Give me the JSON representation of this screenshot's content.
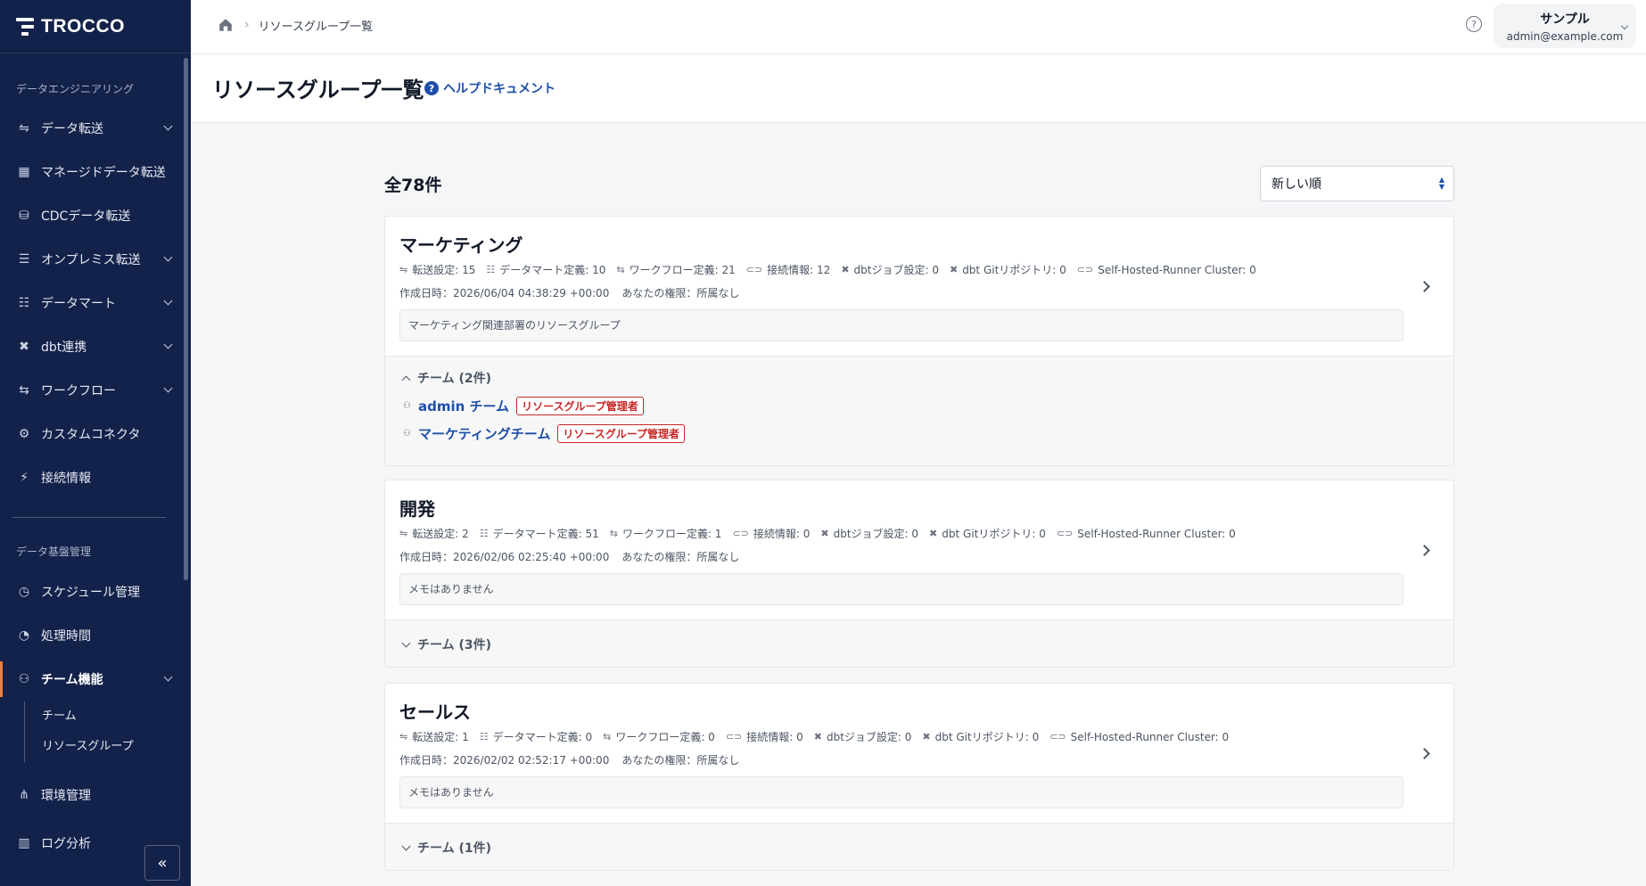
{
  "app": {
    "brand": "TROCCO"
  },
  "sidebar": {
    "section1": "データエンジニアリング",
    "items1": [
      {
        "label": "データ転送",
        "icon": "transfer-icon",
        "glyph": "⇋"
      },
      {
        "label": "マネージドデータ転送",
        "icon": "grid-icon",
        "glyph": "▦"
      },
      {
        "label": "CDCデータ転送",
        "icon": "cdc-icon",
        "glyph": "⛁"
      },
      {
        "label": "オンプレミス転送",
        "icon": "server-icon",
        "glyph": "☰"
      },
      {
        "label": "データマート",
        "icon": "database-icon",
        "glyph": "☷"
      },
      {
        "label": "dbt連携",
        "icon": "dbt-icon",
        "glyph": "✖"
      },
      {
        "label": "ワークフロー",
        "icon": "workflow-icon",
        "glyph": "⇆"
      },
      {
        "label": "カスタムコネクタ",
        "icon": "connector-icon",
        "glyph": "⚙"
      },
      {
        "label": "接続情報",
        "icon": "plug-icon",
        "glyph": "⚡"
      }
    ],
    "section2": "データ基盤管理",
    "items2": [
      {
        "label": "スケジュール管理",
        "icon": "clock-icon",
        "glyph": "◷"
      },
      {
        "label": "処理時間",
        "icon": "timer-icon",
        "glyph": "◔"
      },
      {
        "label": "チーム機能",
        "icon": "team-icon",
        "glyph": "⚇"
      }
    ],
    "sub": [
      "チーム",
      "リソースグループ"
    ],
    "items3": [
      {
        "label": "環境管理",
        "icon": "hierarchy-icon",
        "glyph": "⋔"
      },
      {
        "label": "ログ分析",
        "icon": "chart-icon",
        "glyph": "▥"
      }
    ],
    "collapse": "«"
  },
  "header": {
    "breadcrumb": "リソースグループ一覧",
    "help": "?",
    "user_name": "サンプル",
    "user_email": "admin@example.com"
  },
  "page": {
    "title": "リソースグループ一覧",
    "help_link": "ヘルプドキュメント",
    "count": "全78件",
    "sort": "新しい順"
  },
  "groups": [
    {
      "name": "マーケティング",
      "stats": [
        {
          "icon": "transfer-icon",
          "glyph": "⇋",
          "text": "転送設定: 15"
        },
        {
          "icon": "database-icon",
          "glyph": "☷",
          "text": "データマート定義: 10"
        },
        {
          "icon": "workflow-icon",
          "glyph": "⇆",
          "text": "ワークフロー定義: 21"
        },
        {
          "icon": "link-icon",
          "glyph": "⊂⊃",
          "text": "接続情報: 12"
        },
        {
          "icon": "dbt-icon",
          "glyph": "✖",
          "text": "dbtジョブ設定: 0"
        },
        {
          "icon": "dbt-icon",
          "glyph": "✖",
          "text": "dbt Gitリポジトリ: 0"
        },
        {
          "icon": "link-icon",
          "glyph": "⊂⊃",
          "text": "Self-Hosted-Runner Cluster: 0"
        }
      ],
      "created": "作成日時：2026/06/04 04:38:29 +00:00",
      "permission": "あなたの権限：所属なし",
      "memo": "マーケティング関連部署のリソースグループ",
      "teams_label": "チーム (2件)",
      "teams": [
        {
          "name": "admin チーム",
          "role": "リソースグループ管理者"
        },
        {
          "name": "マーケティングチーム",
          "role": "リソースグループ管理者"
        }
      ]
    },
    {
      "name": "開発",
      "stats": [
        {
          "icon": "transfer-icon",
          "glyph": "⇋",
          "text": "転送設定: 2"
        },
        {
          "icon": "database-icon",
          "glyph": "☷",
          "text": "データマート定義: 51"
        },
        {
          "icon": "workflow-icon",
          "glyph": "⇆",
          "text": "ワークフロー定義: 1"
        },
        {
          "icon": "link-icon",
          "glyph": "⊂⊃",
          "text": "接続情報: 0"
        },
        {
          "icon": "dbt-icon",
          "glyph": "✖",
          "text": "dbtジョブ設定: 0"
        },
        {
          "icon": "dbt-icon",
          "glyph": "✖",
          "text": "dbt Gitリポジトリ: 0"
        },
        {
          "icon": "link-icon",
          "glyph": "⊂⊃",
          "text": "Self-Hosted-Runner Cluster: 0"
        }
      ],
      "created": "作成日時：2026/02/06 02:25:40 +00:00",
      "permission": "あなたの権限：所属なし",
      "memo": "メモはありません",
      "teams_label": "チーム (3件)",
      "teams": []
    },
    {
      "name": "セールス",
      "stats": [
        {
          "icon": "transfer-icon",
          "glyph": "⇋",
          "text": "転送設定: 1"
        },
        {
          "icon": "database-icon",
          "glyph": "☷",
          "text": "データマート定義: 0"
        },
        {
          "icon": "workflow-icon",
          "glyph": "⇆",
          "text": "ワークフロー定義: 0"
        },
        {
          "icon": "link-icon",
          "glyph": "⊂⊃",
          "text": "接続情報: 0"
        },
        {
          "icon": "dbt-icon",
          "glyph": "✖",
          "text": "dbtジョブ設定: 0"
        },
        {
          "icon": "dbt-icon",
          "glyph": "✖",
          "text": "dbt Gitリポジトリ: 0"
        },
        {
          "icon": "link-icon",
          "glyph": "⊂⊃",
          "text": "Self-Hosted-Runner Cluster: 0"
        }
      ],
      "created": "作成日時：2026/02/02 02:52:17 +00:00",
      "permission": "あなたの権限：所属なし",
      "memo": "メモはありません",
      "teams_label": "チーム (1件)",
      "teams": []
    }
  ]
}
